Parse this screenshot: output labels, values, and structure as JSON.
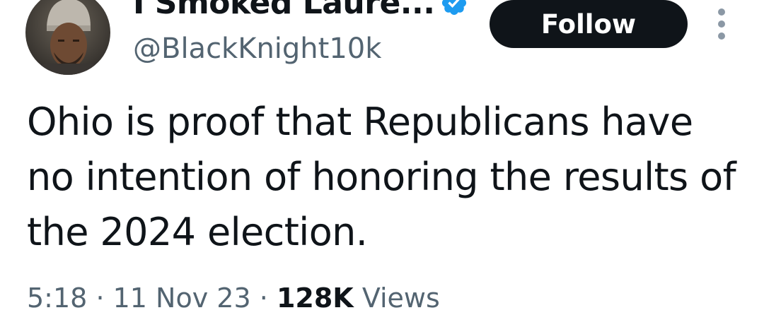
{
  "tweet": {
    "author": {
      "display_name": "I Smoked Laure...",
      "handle": "@BlackKnight10k",
      "verified": true,
      "avatar_icon": "profile-photo"
    },
    "follow_label": "Follow",
    "more_icon": "vertical-ellipsis-icon",
    "text": "Ohio is proof that Republicans have no intention of honoring the results of the 2024 election.",
    "time": "5:18",
    "separator": "·",
    "date": "11 Nov 23",
    "views_count": "128K",
    "views_label": "Views"
  },
  "colors": {
    "text_primary": "#0f1419",
    "text_secondary": "#536471",
    "verified_blue": "#1d9bf0",
    "follow_bg": "#0f1419"
  }
}
